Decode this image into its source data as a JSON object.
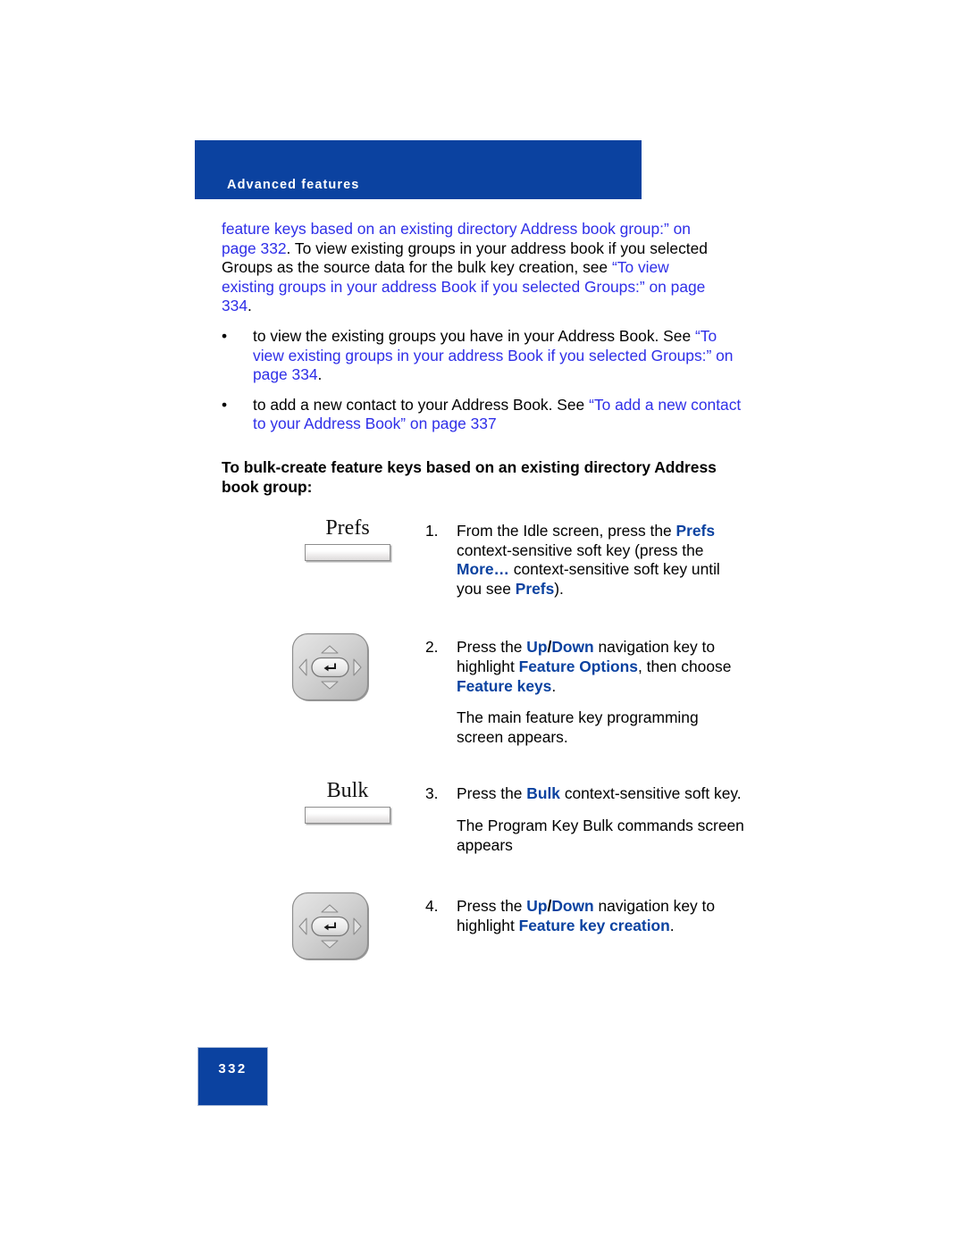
{
  "header": {
    "section_label": "Advanced features",
    "bar_color": "#0B42A0"
  },
  "colors": {
    "link": "#2F2FE8",
    "emphasis": "#0B42A0",
    "body": "#000000"
  },
  "lead_paragraph": {
    "seg1_link": "feature keys based on an existing directory Address book group:” on page 332",
    "seg2_plain": ". To view existing groups in your address book if you selected Groups as the source data for the bulk key creation, see ",
    "seg3_link": "“To view existing groups in your address Book if you selected Groups:” on page 334",
    "seg4_plain": "."
  },
  "bullets": [
    {
      "mark": "•",
      "plain_lead": "to view the existing groups you have in your Address Book. See ",
      "link": "“To view existing groups in your address Book if you selected Groups:” on page 334",
      "plain_tail": "."
    },
    {
      "mark": "•",
      "plain_lead": "to add a new contact to your Address Book. See ",
      "link": "“To add a new contact to your Address Book” on page 337",
      "plain_tail": ""
    }
  ],
  "subheading": "To bulk-create feature keys based on an existing directory Address book group:",
  "steps": [
    {
      "number": "1.",
      "art": "softkey",
      "art_label": "Prefs",
      "paragraphs": [
        [
          {
            "t": "plain",
            "v": "From the Idle screen, press the "
          },
          {
            "t": "emph",
            "v": "Prefs"
          },
          {
            "t": "plain",
            "v": " context-sensitive soft key (press the "
          },
          {
            "t": "emph",
            "v": "More…"
          },
          {
            "t": "plain",
            "v": " context-sensitive soft key until you see "
          },
          {
            "t": "emph",
            "v": "Prefs"
          },
          {
            "t": "plain",
            "v": ")."
          }
        ]
      ]
    },
    {
      "number": "2.",
      "art": "navkey",
      "art_label": "",
      "paragraphs": [
        [
          {
            "t": "plain",
            "v": "Press the "
          },
          {
            "t": "emph",
            "v": "Up"
          },
          {
            "t": "sep",
            "v": "/"
          },
          {
            "t": "emph",
            "v": "Down"
          },
          {
            "t": "plain",
            "v": " navigation key to highlight "
          },
          {
            "t": "emph",
            "v": "Feature Options"
          },
          {
            "t": "plain",
            "v": ", then choose "
          },
          {
            "t": "emph",
            "v": "Feature keys"
          },
          {
            "t": "plain",
            "v": "."
          }
        ],
        [
          {
            "t": "plain",
            "v": "The main feature key programming screen appears."
          }
        ]
      ]
    },
    {
      "number": "3.",
      "art": "softkey",
      "art_label": "Bulk",
      "paragraphs": [
        [
          {
            "t": "plain",
            "v": "Press the "
          },
          {
            "t": "emph",
            "v": "Bulk"
          },
          {
            "t": "plain",
            "v": " context-sensitive soft key."
          }
        ],
        [
          {
            "t": "plain",
            "v": "The Program Key Bulk commands screen appears"
          }
        ]
      ]
    },
    {
      "number": "4.",
      "art": "navkey",
      "art_label": "",
      "paragraphs": [
        [
          {
            "t": "plain",
            "v": "Press the "
          },
          {
            "t": "emph",
            "v": "Up"
          },
          {
            "t": "sep",
            "v": "/"
          },
          {
            "t": "emph",
            "v": "Down"
          },
          {
            "t": "plain",
            "v": " navigation key to highlight "
          },
          {
            "t": "emph",
            "v": "Feature key creation"
          },
          {
            "t": "plain",
            "v": "."
          }
        ]
      ]
    }
  ],
  "footer": {
    "page_number": "332"
  },
  "icons": {
    "nav_up": "triangle-up-icon",
    "nav_down": "triangle-down-icon",
    "nav_left": "triangle-left-icon",
    "nav_right": "triangle-right-icon",
    "nav_center": "enter-arrow-icon"
  }
}
